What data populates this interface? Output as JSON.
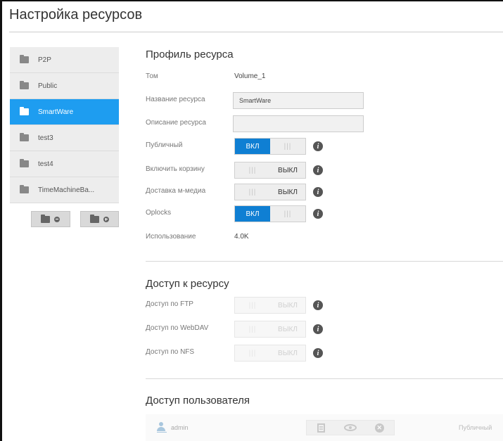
{
  "page": {
    "title": "Настройка ресурсов"
  },
  "sidebar": {
    "shares": [
      {
        "name": "P2P",
        "selected": false
      },
      {
        "name": "Public",
        "selected": false
      },
      {
        "name": "SmartWare",
        "selected": true
      },
      {
        "name": "test3",
        "selected": false
      },
      {
        "name": "test4",
        "selected": false
      },
      {
        "name": "TimeMachineBa...",
        "selected": false
      }
    ],
    "actions": [
      {
        "icon": "folder-remove-icon"
      },
      {
        "icon": "folder-add-icon"
      }
    ],
    "accent_color": "#1e9df0"
  },
  "profile": {
    "title": "Профиль ресурса",
    "volume": {
      "label": "Том",
      "value": "Volume_1"
    },
    "share_name": {
      "label": "Название ресурса",
      "value": "SmartWare"
    },
    "share_description": {
      "label": "Описание ресурса",
      "value": ""
    },
    "public": {
      "label": "Публичный",
      "state": "on",
      "on_label": "ВКЛ"
    },
    "recycle_bin": {
      "label": "Включить корзину",
      "state": "off",
      "off_label": "ВЫКЛ"
    },
    "media_serving": {
      "label": "Доставка м-медиа",
      "state": "off",
      "off_label": "ВЫКЛ"
    },
    "oplocks": {
      "label": "Oplocks",
      "state": "on",
      "on_label": "ВКЛ"
    },
    "usage": {
      "label": "Использование",
      "value": "4.0K"
    }
  },
  "access": {
    "title": "Доступ к ресурсу",
    "ftp": {
      "label": "Доступ по FTP",
      "state": "off",
      "off_label": "ВЫКЛ",
      "disabled": true
    },
    "webdav": {
      "label": "Доступ по WebDAV",
      "state": "off",
      "off_label": "ВЫКЛ",
      "disabled": true
    },
    "nfs": {
      "label": "Доступ по NFS",
      "state": "off",
      "off_label": "ВЫКЛ",
      "disabled": true
    }
  },
  "user_access": {
    "title": "Доступ пользователя",
    "users": [
      {
        "name": "admin",
        "icons": [
          "read-write-icon",
          "read-only-icon",
          "no-access-icon"
        ],
        "status": "Публичный"
      }
    ]
  },
  "colors": {
    "toggle_on": "#0f7fd3",
    "selected": "#1e9df0"
  }
}
